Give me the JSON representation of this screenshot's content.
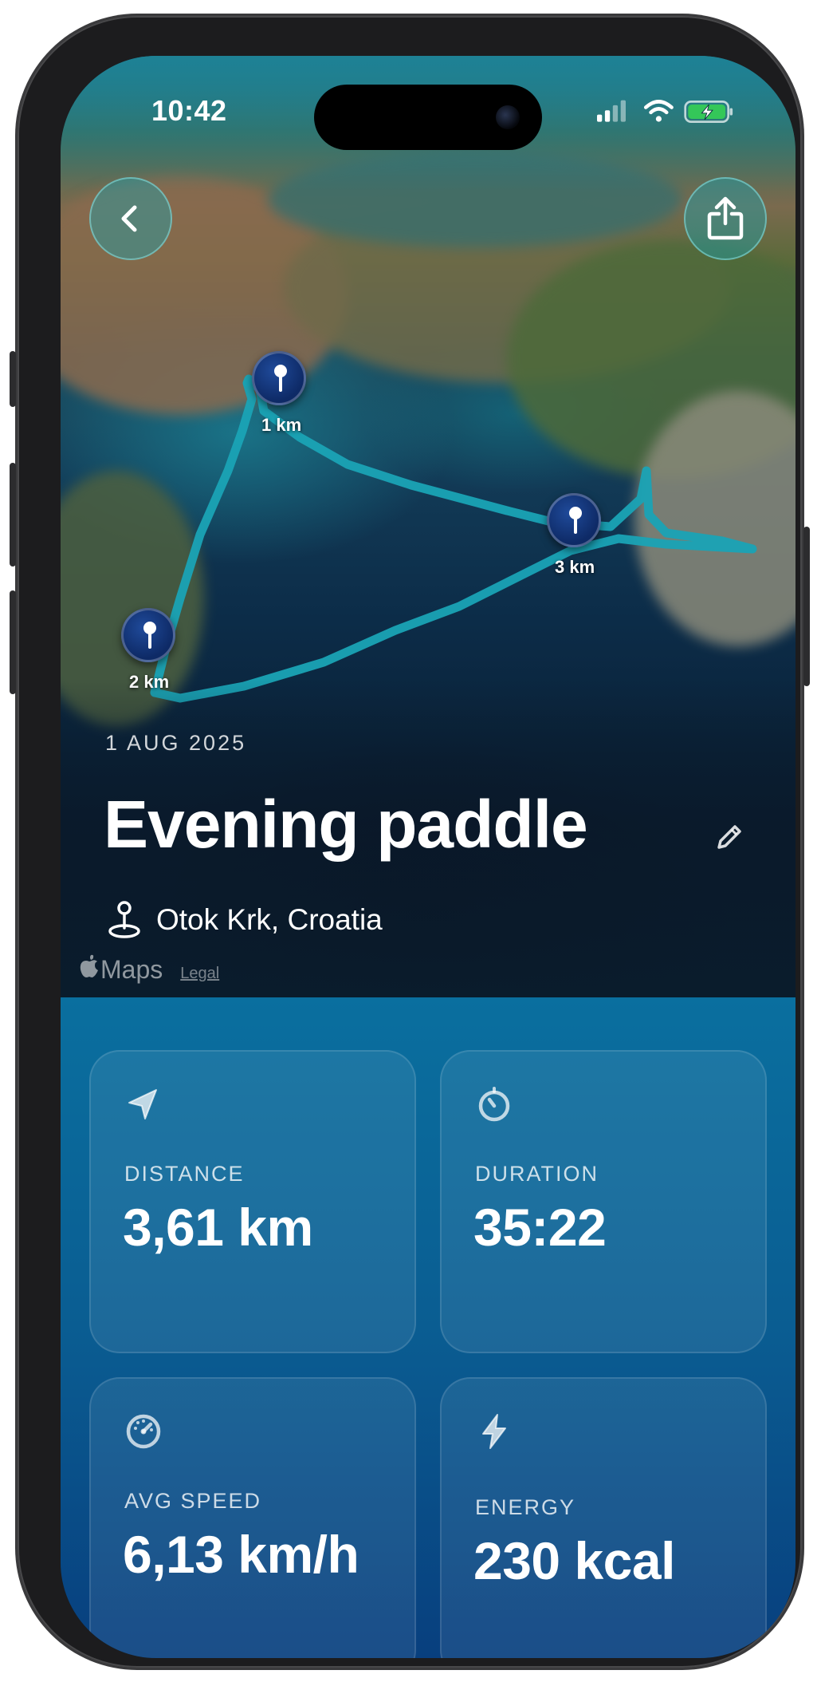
{
  "status_bar": {
    "time": "10:42"
  },
  "header": {
    "back_icon": "chevron-left-icon",
    "share_icon": "share-icon"
  },
  "map": {
    "markers": [
      {
        "label": "1 km"
      },
      {
        "label": "3 km"
      },
      {
        "label": "2 km"
      }
    ],
    "attribution_brand": "Maps",
    "attribution_legal": "Legal",
    "route_color": "#1aa3b5"
  },
  "activity": {
    "date": "1 AUG 2025",
    "title": "Evening paddle",
    "location": "Otok Krk, Croatia"
  },
  "stats": [
    {
      "icon": "location-arrow-icon",
      "label": "DISTANCE",
      "value": "3,61 km"
    },
    {
      "icon": "timer-icon",
      "label": "DURATION",
      "value": "35:22"
    },
    {
      "icon": "speedometer-icon",
      "label": "AVG SPEED",
      "value": "6,13 km/h"
    },
    {
      "icon": "bolt-icon",
      "label": "ENERGY",
      "value": "230 kcal"
    }
  ],
  "colors": {
    "accent": "#1aa3b5",
    "stats_background": "#0a5d92",
    "pin": "#0e2a66"
  }
}
